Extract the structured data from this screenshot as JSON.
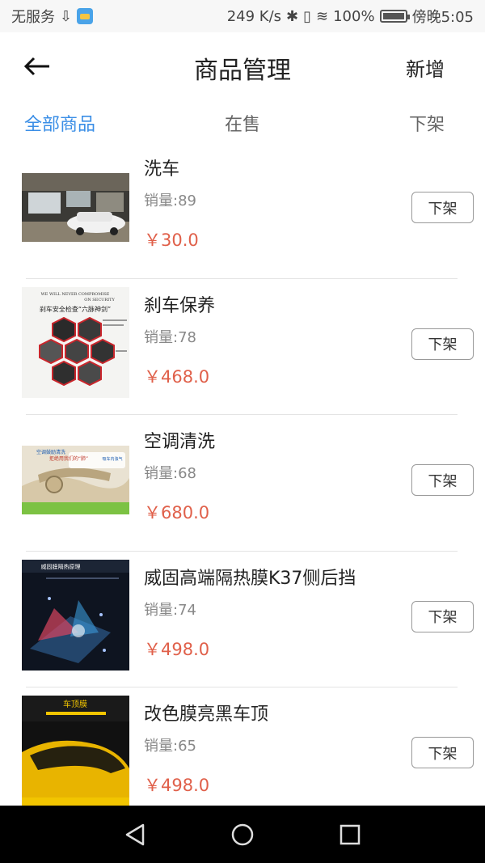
{
  "status_bar": {
    "carrier": "无服务",
    "usb": "⇩",
    "speed": "249 K/s",
    "bluetooth": "✱",
    "vibrate": "▯",
    "wifi": "≋",
    "battery_percent": "100%",
    "time": "傍晚5:05"
  },
  "header": {
    "title": "商品管理",
    "add_label": "新增"
  },
  "tabs": [
    {
      "label": "全部商品",
      "active": true
    },
    {
      "label": "在售",
      "active": false
    },
    {
      "label": "下架",
      "active": false
    }
  ],
  "products": [
    {
      "name": "洗车",
      "sales": "销量:89",
      "price": "￥30.0",
      "action": "下架"
    },
    {
      "name": "刹车保养",
      "sales": "销量:78",
      "price": "￥468.0",
      "action": "下架",
      "image_text": {
        "line1": "WE WILL NEVER COMPROMISE",
        "line2": "ON SECURITY",
        "line3": "刹车安全检查“六脉神剑”"
      }
    },
    {
      "name": "空调清洗",
      "sales": "销量:68",
      "price": "￥680.0",
      "action": "下架",
      "image_text": {
        "line1": "空调鼓励清洗",
        "line2": "拒绝用我们的“肺”",
        "line3": "吸车内浊气"
      }
    },
    {
      "name": "威固高端隔热膜K37侧后挡",
      "sales": "销量:74",
      "price": "￥498.0",
      "action": "下架",
      "image_text": {
        "line1": "威固膜隔热原理"
      }
    },
    {
      "name": "改色膜亮黑车顶",
      "sales": "销量:65",
      "price": "￥498.0",
      "action": "下架",
      "image_text": {
        "line1": "车顶膜"
      }
    }
  ]
}
